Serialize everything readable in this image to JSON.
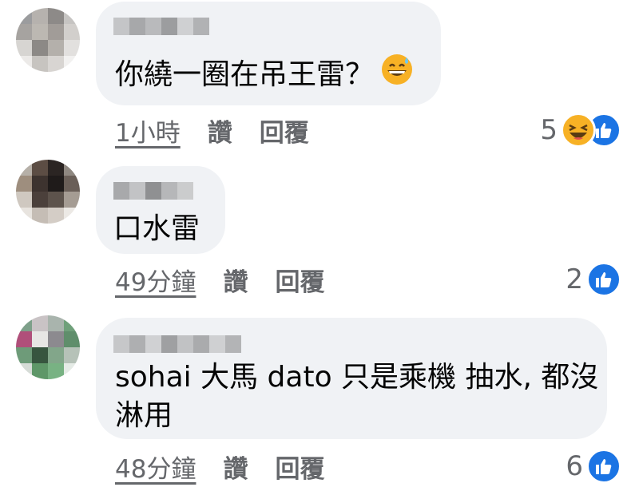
{
  "colors": {
    "bubble": "#f0f2f5",
    "meta_text": "#65676b",
    "like_blue": "#1b74e4",
    "haha_yellow": "#f7b125"
  },
  "comments": [
    {
      "text": "你繞一圈在吊王雷？",
      "inline_emoji": "grinning-sweat-emoji",
      "time": "1小時",
      "like_label": "讚",
      "reply_label": "回覆",
      "reaction_count": "5",
      "reactions": [
        "haha-icon",
        "like-icon"
      ]
    },
    {
      "text": "口水雷",
      "time": "49分鐘",
      "like_label": "讚",
      "reply_label": "回覆",
      "reaction_count": "2",
      "reactions": [
        "like-icon"
      ]
    },
    {
      "text_line1": "sohai 大馬 dato 只是乘機 抽水, 都沒",
      "text_line2": "淋用",
      "time": "48分鐘",
      "like_label": "讚",
      "reply_label": "回覆",
      "reaction_count": "6",
      "reactions": [
        "like-icon"
      ]
    }
  ]
}
